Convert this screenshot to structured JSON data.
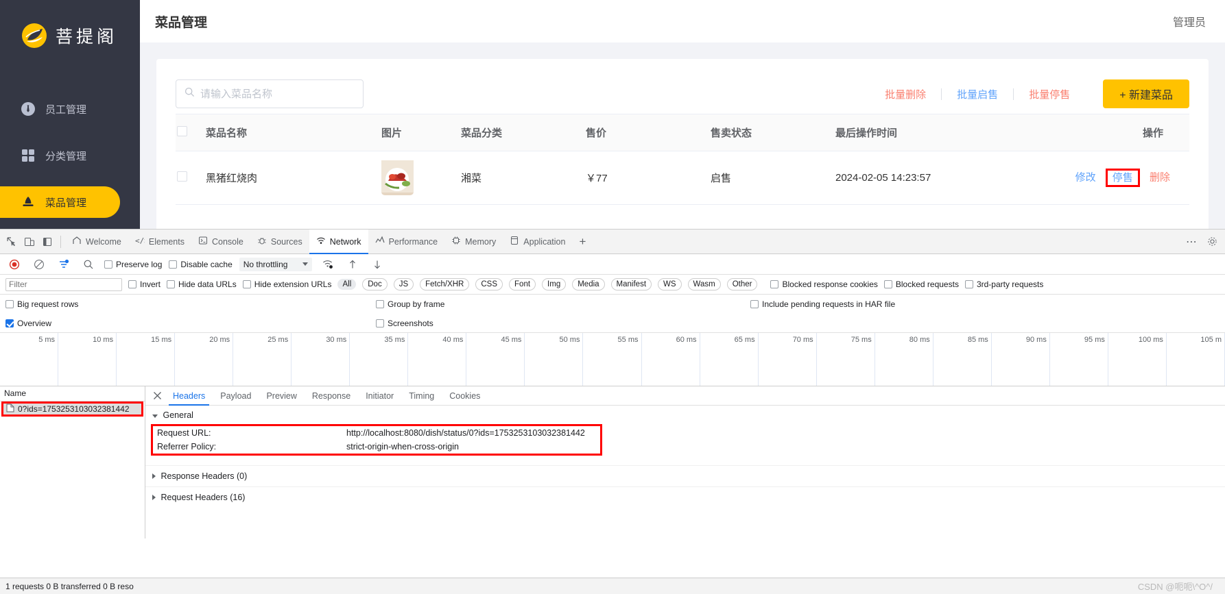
{
  "app": {
    "brand": {
      "text": "菩提阁",
      "logo_icon": "leaf-logo-icon"
    },
    "sidebar": {
      "items": [
        {
          "label": "员工管理",
          "icon": "employee-icon",
          "active": false
        },
        {
          "label": "分类管理",
          "icon": "category-grid-icon",
          "active": false
        },
        {
          "label": "菜品管理",
          "icon": "dish-icon",
          "active": true
        }
      ]
    },
    "topbar": {
      "title": "菜品管理",
      "user": "管理员"
    },
    "search": {
      "placeholder": "请输入菜品名称",
      "value": "",
      "icon": "search-icon"
    },
    "toolbar": {
      "batch_delete": "批量删除",
      "batch_enable": "批量启售",
      "batch_disable": "批量停售",
      "new_dish": "+ 新建菜品"
    },
    "table": {
      "columns": [
        "菜品名称",
        "图片",
        "菜品分类",
        "售价",
        "售卖状态",
        "最后操作时间",
        "操作"
      ],
      "rows": [
        {
          "name": "黑猪红烧肉",
          "image_alt": "dish-thumbnail",
          "category": "湘菜",
          "price": "￥77",
          "status": "启售",
          "updated_at": "2024-02-05 14:23:57",
          "ops": {
            "edit": "修改",
            "stop": "停售",
            "delete": "删除"
          }
        }
      ]
    }
  },
  "devtools": {
    "tabs": [
      {
        "label": "Welcome",
        "icon": "home-icon",
        "active": false
      },
      {
        "label": "Elements",
        "icon": "code-icon",
        "active": false
      },
      {
        "label": "Console",
        "icon": "console-icon",
        "active": false
      },
      {
        "label": "Sources",
        "icon": "bug-icon",
        "active": false
      },
      {
        "label": "Network",
        "icon": "wifi-icon",
        "active": true
      },
      {
        "label": "Performance",
        "icon": "performance-icon",
        "active": false
      },
      {
        "label": "Memory",
        "icon": "memory-icon",
        "active": false
      },
      {
        "label": "Application",
        "icon": "application-icon",
        "active": false
      }
    ],
    "tabbar_plus": "+",
    "more_label": "⋯",
    "toolbar": {
      "record_icon": "record-icon",
      "clear_icon": "clear-icon",
      "filter_icon": "filter-icon",
      "search_icon": "search-icon",
      "preserve_log": "Preserve log",
      "disable_cache": "Disable cache",
      "throttling": "No throttling",
      "throttling_caret": "▼",
      "wifi_icon": "network-conditions-icon",
      "import_icon": "import-har-icon",
      "export_icon": "export-har-icon"
    },
    "filterbar": {
      "filter_placeholder": "Filter",
      "filter_value": "",
      "invert": "Invert",
      "hide_data_urls": "Hide data URLs",
      "hide_extension_urls": "Hide extension URLs",
      "types": [
        "All",
        "Doc",
        "JS",
        "Fetch/XHR",
        "CSS",
        "Font",
        "Img",
        "Media",
        "Manifest",
        "WS",
        "Wasm",
        "Other"
      ],
      "active_type": "All",
      "blocked_response_cookies": "Blocked response cookies",
      "blocked_requests": "Blocked requests",
      "third_party_requests": "3rd-party requests"
    },
    "options": {
      "big_request_rows": "Big request rows",
      "group_by_frame": "Group by frame",
      "include_pending": "Include pending requests in HAR file",
      "overview": "Overview",
      "screenshots": "Screenshots"
    },
    "overview_ticks": [
      "5 ms",
      "10 ms",
      "15 ms",
      "20 ms",
      "25 ms",
      "30 ms",
      "35 ms",
      "40 ms",
      "45 ms",
      "50 ms",
      "55 ms",
      "60 ms",
      "65 ms",
      "70 ms",
      "75 ms",
      "80 ms",
      "85 ms",
      "90 ms",
      "95 ms",
      "100 ms",
      "105 m"
    ],
    "request_list": {
      "header": "Name",
      "rows": [
        {
          "name": "0?ids=1753253103032381442",
          "icon": "document-icon"
        }
      ]
    },
    "detail": {
      "close_icon": "close-icon",
      "tabs": [
        "Headers",
        "Payload",
        "Preview",
        "Response",
        "Initiator",
        "Timing",
        "Cookies"
      ],
      "active_tab": "Headers",
      "general_label": "General",
      "general": [
        {
          "key": "Request URL:",
          "value": "http://localhost:8080/dish/status/0?ids=1753253103032381442"
        },
        {
          "key": "Referrer Policy:",
          "value": "strict-origin-when-cross-origin"
        }
      ],
      "response_headers": "Response Headers (0)",
      "request_headers": "Request Headers (16)"
    },
    "status": {
      "text": "1 requests  0 B transferred  0 B reso",
      "watermark": "CSDN @呃呃\\^O^/"
    }
  },
  "colors": {
    "brand_yellow": "#ffc200",
    "sidebar_bg": "#343744",
    "link_blue": "#60a3fb",
    "link_red": "#fa7f6f",
    "annotation_red": "#ff0000",
    "devtools_accent": "#1a73e8"
  }
}
